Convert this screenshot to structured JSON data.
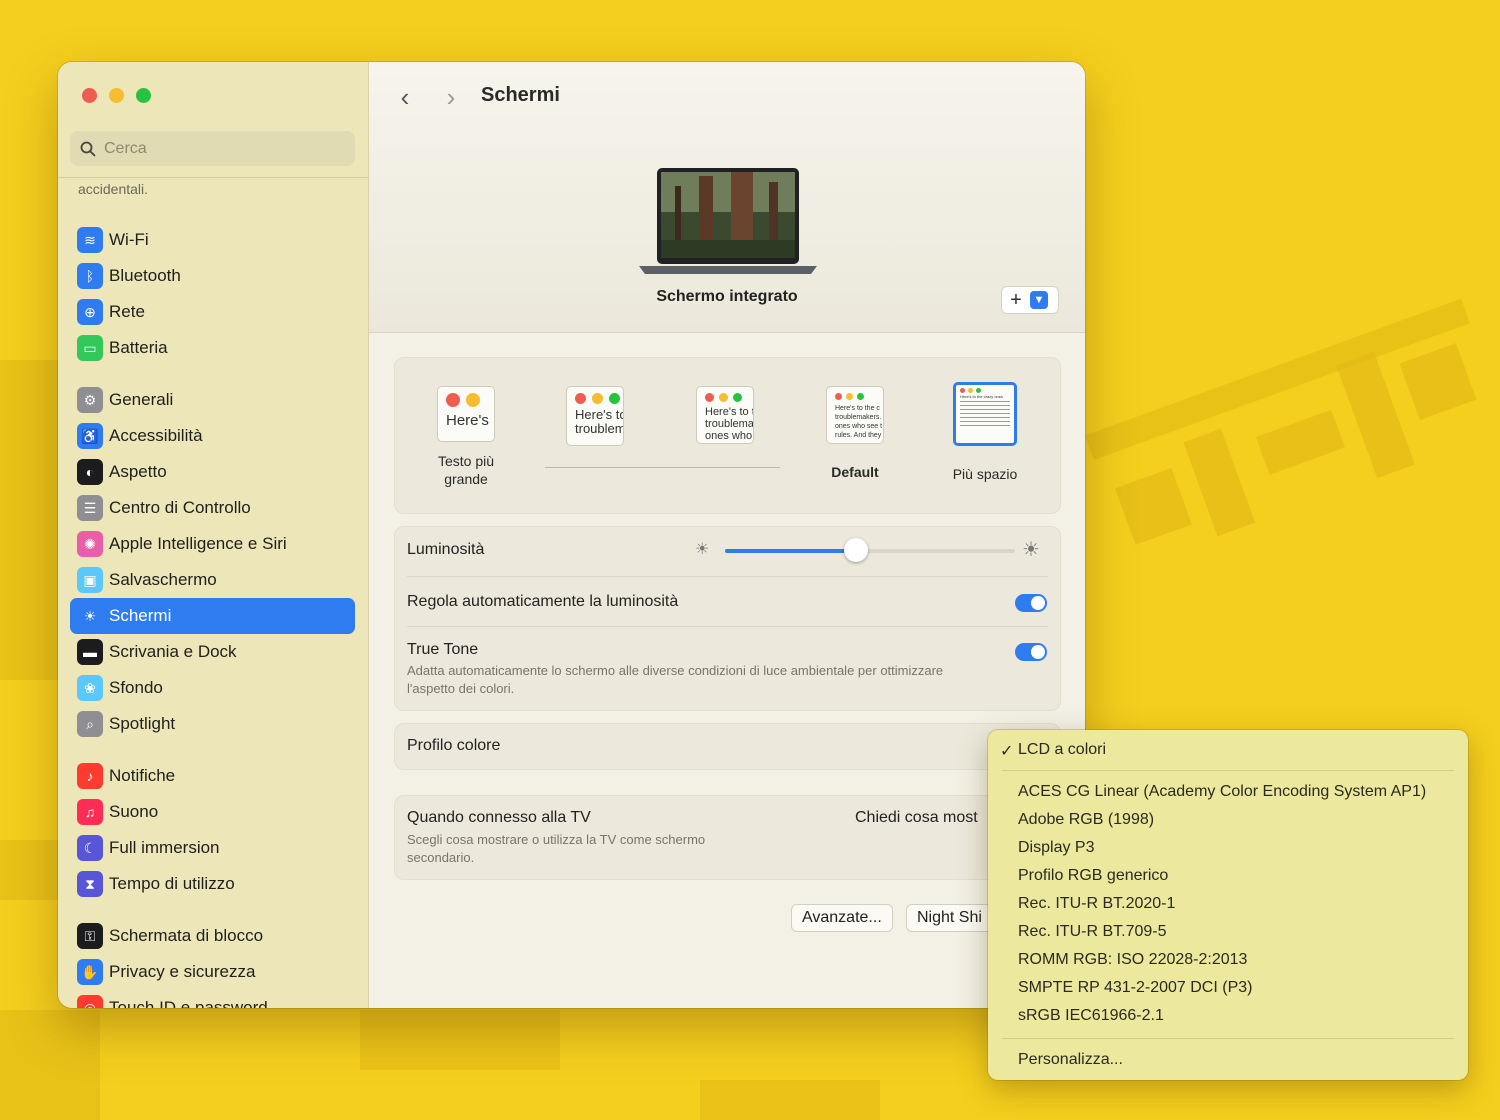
{
  "sidebar": {
    "search_placeholder": "Cerca",
    "cut_text": "accidentali.",
    "items": [
      {
        "label": "Wi-Fi",
        "icon": "wifi-icon",
        "color": "#2f7cf0"
      },
      {
        "label": "Bluetooth",
        "icon": "bluetooth-icon",
        "color": "#2f7cf0"
      },
      {
        "label": "Rete",
        "icon": "globe-icon",
        "color": "#2f7cf0"
      },
      {
        "label": "Batteria",
        "icon": "battery-icon",
        "color": "#34c759"
      },
      {
        "label": "Generali",
        "icon": "gear-icon",
        "color": "#8e8e93"
      },
      {
        "label": "Accessibilità",
        "icon": "accessibility-icon",
        "color": "#2f7cf0"
      },
      {
        "label": "Aspetto",
        "icon": "appearance-icon",
        "color": "#1c1c1e"
      },
      {
        "label": "Centro di Controllo",
        "icon": "control-center-icon",
        "color": "#8e8e93"
      },
      {
        "label": "Apple Intelligence e Siri",
        "icon": "siri-icon",
        "color": "#e85ea8"
      },
      {
        "label": "Salvaschermo",
        "icon": "screensaver-icon",
        "color": "#5ac8fa"
      },
      {
        "label": "Schermi",
        "icon": "sun-icon",
        "color": "#2f7cf0",
        "active": true
      },
      {
        "label": "Scrivania e Dock",
        "icon": "dock-icon",
        "color": "#1c1c1e"
      },
      {
        "label": "Sfondo",
        "icon": "wallpaper-icon",
        "color": "#5ac8fa"
      },
      {
        "label": "Spotlight",
        "icon": "magnifier-icon",
        "color": "#8e8e93"
      },
      {
        "label": "Notifiche",
        "icon": "bell-icon",
        "color": "#ff3b30"
      },
      {
        "label": "Suono",
        "icon": "speaker-icon",
        "color": "#ff2d55"
      },
      {
        "label": "Full immersion",
        "icon": "moon-icon",
        "color": "#5856d6"
      },
      {
        "label": "Tempo di utilizzo",
        "icon": "hourglass-icon",
        "color": "#5856d6"
      },
      {
        "label": "Schermata di blocco",
        "icon": "lock-icon",
        "color": "#1c1c1e"
      },
      {
        "label": "Privacy e sicurezza",
        "icon": "hand-icon",
        "color": "#2f7cf0"
      },
      {
        "label": "Touch ID e password",
        "icon": "fingerprint-icon",
        "color": "#ff3b30"
      }
    ]
  },
  "header": {
    "title": "Schermi",
    "back": "‹",
    "forward": "›",
    "display_name": "Schermo integrato",
    "add": "+"
  },
  "resolution": {
    "options": [
      {
        "label": "Testo più\ngrande",
        "sample": "Here's"
      },
      {
        "label": "",
        "sample": "Here's to\ntroublem"
      },
      {
        "label": "",
        "sample": "Here's to t\ntroublema\nones who"
      },
      {
        "label": "Default",
        "sample": "Here's to the c\ntroublemakers.\nones who see t\nrules. And they"
      },
      {
        "label": "Più spazio",
        "sample": "Here's to the crazy ones"
      }
    ]
  },
  "brightness": {
    "label": "Luminosità",
    "value": 0.45
  },
  "auto_brightness": {
    "label": "Regola automaticamente la luminosità",
    "on": true
  },
  "true_tone": {
    "label": "True Tone",
    "description": "Adatta automaticamente lo schermo alle diverse condizioni di luce ambientale per ottimizzare l'aspetto dei colori.",
    "on": true
  },
  "color_profile": {
    "label": "Profilo colore"
  },
  "tv": {
    "label": "Quando connesso alla TV",
    "description": "Scegli cosa mostrare o utilizza la TV come schermo secondario.",
    "value": "Chiedi cosa most"
  },
  "buttons": {
    "advanced": "Avanzate...",
    "night_shift": "Night Shi"
  },
  "menu": {
    "selected": "LCD a colori",
    "checkmark": "✓",
    "options": [
      "ACES CG Linear (Academy Color Encoding System AP1)",
      "Adobe RGB (1998)",
      "Display P3",
      "Profilo RGB generico",
      "Rec. ITU-R BT.2020-1",
      "Rec. ITU-R BT.709-5",
      "ROMM RGB: ISO 22028-2:2013",
      "SMPTE RP 431-2-2007 DCI (P3)",
      "sRGB IEC61966-2.1"
    ],
    "customize": "Personalizza..."
  },
  "colors": {
    "accent": "#2f7cf0",
    "background": "#f5cf1d"
  }
}
